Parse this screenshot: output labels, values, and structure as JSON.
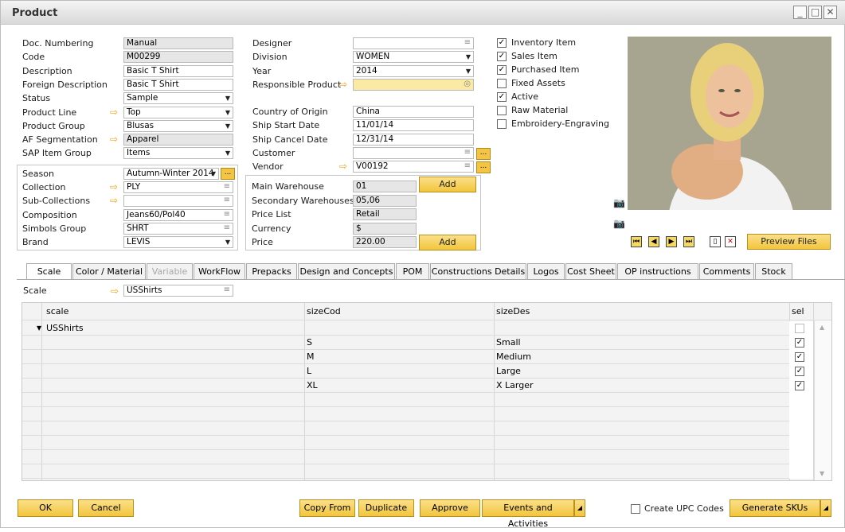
{
  "window": {
    "title": "Product"
  },
  "header_left": [
    {
      "label": "Doc. Numbering",
      "value": "Manual",
      "style": "ro"
    },
    {
      "label": "Code",
      "value": "M00299",
      "style": "ro"
    },
    {
      "label": "Description",
      "value": "Basic T Shirt",
      "style": ""
    },
    {
      "label": "Foreign Description",
      "value": "Basic T Shirt",
      "style": ""
    },
    {
      "label": "Status",
      "value": "Sample",
      "style": "dd"
    },
    {
      "label": "Product Line",
      "value": "Top",
      "style": "dd",
      "arrow": true
    },
    {
      "label": "Product Group",
      "value": "Blusas",
      "style": "dd"
    },
    {
      "label": "AF Segmentation",
      "value": "Apparel",
      "style": "ro",
      "arrow": true
    },
    {
      "label": "SAP Item Group",
      "value": "Items",
      "style": "dd"
    }
  ],
  "header_left2": [
    {
      "label": "Season",
      "value": "Autumn-Winter 2014",
      "style": "dd"
    },
    {
      "label": "Collection",
      "value": "PLY",
      "style": "lst",
      "arrow": true
    },
    {
      "label": "Sub-Collections",
      "value": "",
      "style": "lst",
      "arrow": true
    },
    {
      "label": "Composition",
      "value": "Jeans60/Pol40",
      "style": "lst"
    },
    {
      "label": "Simbols Group",
      "value": "SHRT",
      "style": "lst"
    },
    {
      "label": "Brand",
      "value": "LEVIS",
      "style": "dd"
    }
  ],
  "header_mid": [
    {
      "label": "Designer",
      "value": "",
      "style": "lst"
    },
    {
      "label": "Division",
      "value": "WOMEN",
      "style": "dd"
    },
    {
      "label": "Year",
      "value": "2014",
      "style": "dd"
    },
    {
      "label": "Responsible Product",
      "value": "",
      "style": "hl",
      "arrow": true
    }
  ],
  "header_mid2": [
    {
      "label": "Country of Origin",
      "value": "China",
      "style": ""
    },
    {
      "label": "Ship Start Date",
      "value": "11/01/14",
      "style": ""
    },
    {
      "label": "Ship Cancel Date",
      "value": "12/31/14",
      "style": ""
    },
    {
      "label": "Customer",
      "value": "",
      "style": "lst"
    },
    {
      "label": "Vendor",
      "value": "V00192",
      "style": "lst",
      "arrow": true
    }
  ],
  "warehouse": [
    {
      "label": "Main Warehouse",
      "value": "01"
    },
    {
      "label": "Secondary Warehouses",
      "value": "05,06"
    },
    {
      "label": "Price List",
      "value": "Retail"
    },
    {
      "label": "Currency",
      "value": "$"
    },
    {
      "label": "Price",
      "value": "220.00"
    }
  ],
  "add_label": "Add",
  "dots_label": "...",
  "checkboxes": [
    {
      "label": "Inventory Item",
      "checked": true
    },
    {
      "label": "Sales Item",
      "checked": true
    },
    {
      "label": "Purchased Item",
      "checked": true
    },
    {
      "label": "Fixed Assets",
      "checked": false
    },
    {
      "label": "Active",
      "checked": true
    },
    {
      "label": "Raw Material",
      "checked": false
    },
    {
      "label": "Embroidery-Engraving",
      "checked": false
    }
  ],
  "preview_label": "Preview Files",
  "tabs": [
    {
      "label": "Scale",
      "state": "active"
    },
    {
      "label": "Color / Material",
      "state": ""
    },
    {
      "label": "Variable",
      "state": "disabled"
    },
    {
      "label": "WorkFlow",
      "state": ""
    },
    {
      "label": "Prepacks",
      "state": ""
    },
    {
      "label": "Design and Concepts",
      "state": ""
    },
    {
      "label": "POM",
      "state": ""
    },
    {
      "label": "Constructions Details",
      "state": ""
    },
    {
      "label": "Logos",
      "state": ""
    },
    {
      "label": "Cost Sheet",
      "state": ""
    },
    {
      "label": "OP instructions",
      "state": ""
    },
    {
      "label": "Comments",
      "state": ""
    },
    {
      "label": "Stock",
      "state": ""
    }
  ],
  "scale": {
    "label": "Scale",
    "value": "USShirts"
  },
  "grid": {
    "headers": [
      "scale",
      "sizeCod",
      "sizeDes",
      "sel"
    ],
    "group": "USShirts",
    "rows": [
      {
        "code": "S",
        "desc": "Small",
        "sel": true
      },
      {
        "code": "M",
        "desc": "Medium",
        "sel": true
      },
      {
        "code": "L",
        "desc": "Large",
        "sel": true
      },
      {
        "code": "XL",
        "desc": "X Larger",
        "sel": true
      }
    ]
  },
  "footer": {
    "ok": "OK",
    "cancel": "Cancel",
    "copy_from": "Copy From",
    "duplicate": "Duplicate",
    "approve": "Approve",
    "events": "Events and Activities",
    "create_upc": "Create UPC Codes",
    "generate": "Generate SKUs"
  }
}
